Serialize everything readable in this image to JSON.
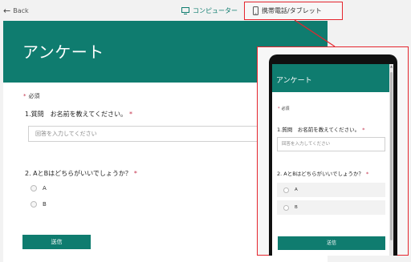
{
  "topbar": {
    "back_label": "Back",
    "device_computer_label": "コンピューター",
    "device_mobile_label": "携帯電話/タブレット"
  },
  "form": {
    "title": "アンケート",
    "required_label": "必須",
    "question1": {
      "label": "1.質問　お名前を教えてください。",
      "required_mark": "*",
      "input_placeholder": "回答を入力してください"
    },
    "question2": {
      "label": "2. AとBはどちらがいいでしょうか？",
      "required_mark": "*",
      "options": [
        "A",
        "B"
      ]
    },
    "submit_label": "送信"
  },
  "mobile_preview": {
    "title": "アンケート",
    "required_label": "必須",
    "question1_label": "1.質問　お名前を教えてください。",
    "input_placeholder": "回答を入力してください",
    "question2_label": "2. AとBはどちらがいいでしょうか？",
    "options": [
      "A",
      "B"
    ],
    "submit_label": "送信"
  },
  "colors": {
    "accent": "#0f7c6f",
    "highlight": "#e5262e",
    "required": "#c4314b"
  }
}
